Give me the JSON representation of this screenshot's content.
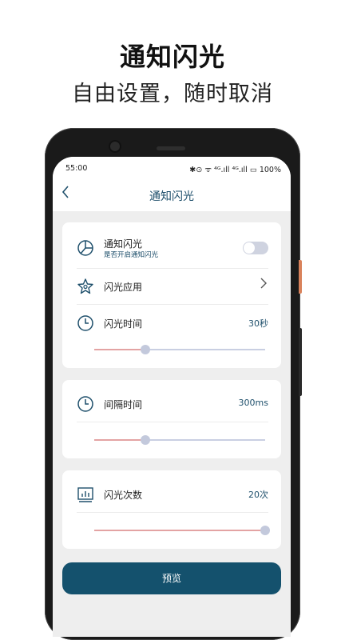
{
  "promo": {
    "title": "通知闪光",
    "subtitle": "自由设置，随时取消"
  },
  "status_bar": {
    "time": "55:00",
    "indicators": "✱⊙ ᯤ ⁴ᴳ.ıll ⁴ᴳ.ıll ▭ 100%"
  },
  "app_bar": {
    "title": "通知闪光"
  },
  "card1": {
    "notify": {
      "label": "通知闪光",
      "sublabel": "是否开启通知闪光",
      "enabled": false
    },
    "flash_app": {
      "label": "闪光应用"
    },
    "flash_time": {
      "label": "闪光时间",
      "value": "30秒",
      "level": 0.3
    }
  },
  "card2": {
    "interval": {
      "label": "间隔时间",
      "value": "300ms",
      "level": 0.3
    }
  },
  "card3": {
    "count": {
      "label": "闪光次数",
      "value": "20次",
      "level": 1.0
    }
  },
  "preview_button": {
    "label": "预览"
  },
  "colors": {
    "accent": "#1e4f6b",
    "button": "#14516d",
    "slider_fill": "#e3a3a3",
    "slider_track": "#c9cfe2"
  }
}
